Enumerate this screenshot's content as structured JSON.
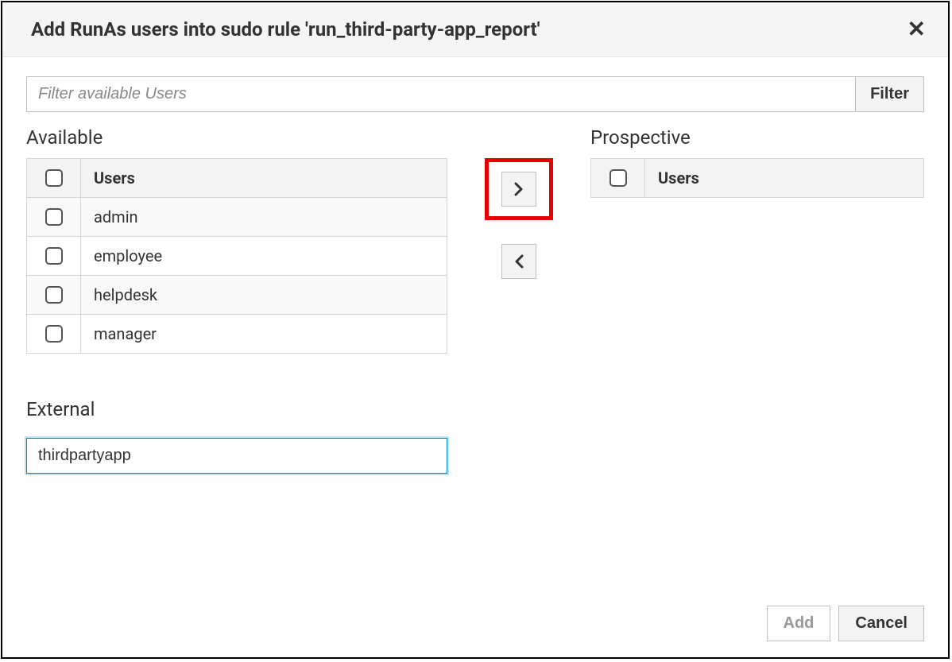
{
  "dialog": {
    "title": "Add RunAs users into sudo rule 'run_third-party-app_report'"
  },
  "filter": {
    "placeholder": "Filter available Users",
    "button_label": "Filter"
  },
  "available": {
    "heading": "Available",
    "column_header": "Users",
    "items": [
      "admin",
      "employee",
      "helpdesk",
      "manager"
    ]
  },
  "prospective": {
    "heading": "Prospective",
    "column_header": "Users",
    "items": []
  },
  "external": {
    "heading": "External",
    "value": "thirdpartyapp"
  },
  "footer": {
    "add_label": "Add",
    "cancel_label": "Cancel"
  }
}
